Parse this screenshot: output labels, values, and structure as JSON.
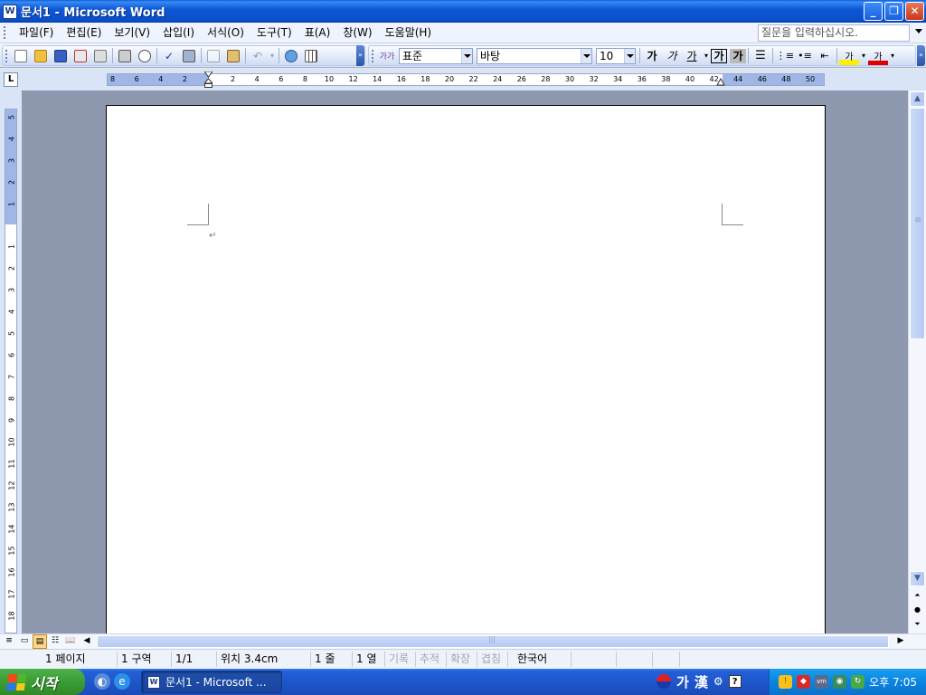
{
  "window": {
    "title": "문서1 - Microsoft Word",
    "app_icon": "W"
  },
  "menu": {
    "items": [
      "파일(F)",
      "편집(E)",
      "보기(V)",
      "삽입(I)",
      "서식(O)",
      "도구(T)",
      "표(A)",
      "창(W)",
      "도움말(H)"
    ],
    "help_placeholder": "질문을 입력하십시오."
  },
  "toolbar": {
    "style_value": "표준",
    "font_value": "바탕",
    "size_value": "10",
    "bold_label": "가",
    "italic_label": "가",
    "underline_label": "가",
    "char_border_label": "가",
    "char_shade_label": "가",
    "style_icon_label": "가가",
    "highlight_label": "가",
    "font_color_label": "가"
  },
  "ruler": {
    "left_numbers": [
      "8",
      "6",
      "4",
      "2"
    ],
    "right_numbers": [
      "2",
      "4",
      "6",
      "8",
      "10",
      "12",
      "14",
      "16",
      "18",
      "20",
      "22",
      "24",
      "26",
      "28",
      "30",
      "32",
      "34",
      "36",
      "38",
      "40",
      "42",
      "44",
      "46",
      "48",
      "50"
    ],
    "vertical_numbers": [
      "5",
      "4",
      "3",
      "2",
      "1",
      "1",
      "2",
      "3",
      "4",
      "5",
      "6",
      "7",
      "8",
      "9",
      "10",
      "11",
      "12",
      "13",
      "14",
      "15",
      "16",
      "17",
      "18"
    ]
  },
  "document": {
    "paragraph_mark": "↵"
  },
  "status": {
    "page": "1 페이지",
    "section": "1 구역",
    "page_of": "1/1",
    "position": "위치 3.4cm",
    "line": "1 줄",
    "column": "1 열",
    "rec": "기록",
    "trk": "추적",
    "ext": "확장",
    "ovr": "겹침",
    "language": "한국어"
  },
  "taskbar": {
    "start_label": "시작",
    "task_label": "문서1 - Microsoft ...",
    "task_icon": "W",
    "ime_hangul": "가",
    "ime_hanja": "漢",
    "clock": "오후 7:05"
  },
  "colors": {
    "titlebar": "#0a4fc8",
    "workspace": "#8e98ae",
    "page": "#ffffff",
    "taskbar": "#1f56cc",
    "start": "#3a9c34",
    "tray": "#0b84e0"
  }
}
